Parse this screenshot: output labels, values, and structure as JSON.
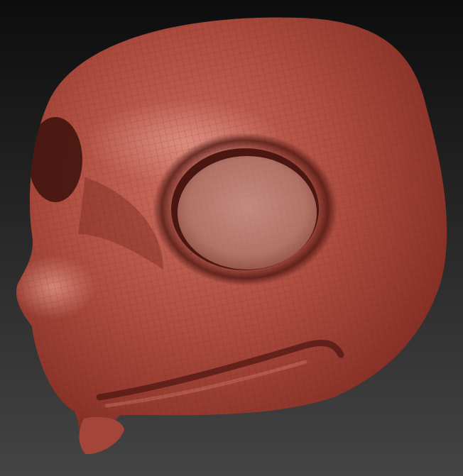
{
  "viewport": {
    "background_top": "#0d0d0d",
    "background_bottom": "#444444"
  },
  "model": {
    "material_base": "#a8453a",
    "material_light": "#d77b6d",
    "material_shadow": "#5e1d16",
    "wire_color": "#5a1e16"
  }
}
